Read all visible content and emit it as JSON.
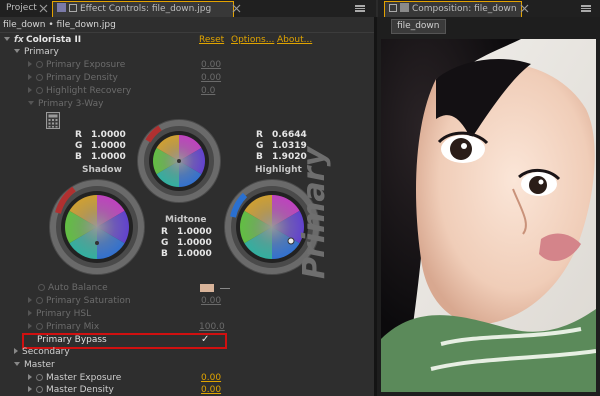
{
  "left_tabs": {
    "project": "Project",
    "effect_controls": "Effect Controls: file_down.jpg"
  },
  "right_tabs": {
    "composition": "Composition: file_down",
    "subtab": "file_down"
  },
  "breadcrumb": "file_down • file_down.jpg",
  "effect": {
    "fx": "fx",
    "name": "Colorista II",
    "reset": "Reset",
    "options": "Options...",
    "about": "About..."
  },
  "primary": {
    "label": "Primary",
    "exposure_label": "Primary Exposure",
    "exposure_value": "0.00",
    "density_label": "Primary Density",
    "density_value": "0.00",
    "highlight_recovery_label": "Highlight Recovery",
    "highlight_recovery_value": "0.0",
    "three_way_label": "Primary 3-Way",
    "auto_balance_label": "Auto Balance",
    "saturation_label": "Primary Saturation",
    "saturation_value": "0.00",
    "hsl_label": "Primary HSL",
    "mix_label": "Primary Mix",
    "mix_value": "100.0",
    "bypass_label": "Primary Bypass",
    "bypass_check": "✓"
  },
  "wheels": {
    "panel_title": "Primary",
    "shadow": {
      "label": "Shadow",
      "R": "1.0000",
      "G": "1.0000",
      "B": "1.0000"
    },
    "midtone": {
      "label": "Midtone",
      "R": "1.0000",
      "G": "1.0000",
      "B": "1.0000"
    },
    "highlight": {
      "label": "Highlight",
      "R": "0.6644",
      "G": "1.0319",
      "B": "1.9020"
    },
    "r": "R",
    "g": "G",
    "b": "B"
  },
  "secondary": {
    "label": "Secondary"
  },
  "master": {
    "label": "Master",
    "exposure_label": "Master Exposure",
    "exposure_value": "0.00",
    "density_label": "Master Density",
    "density_value": "0.00"
  },
  "colors": {
    "accent": "#e0a400",
    "bypass_box": "#d01010"
  }
}
